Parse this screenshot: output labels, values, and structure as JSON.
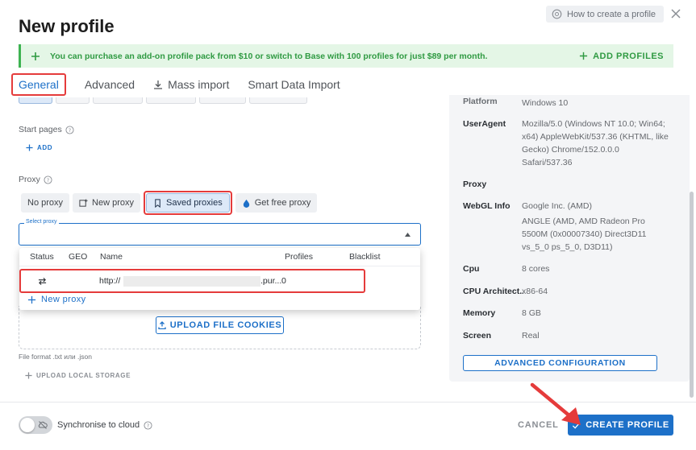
{
  "header": {
    "title": "New profile",
    "howto_label": "How to create a profile"
  },
  "banner": {
    "message": "You can purchase an add-on profile pack from $10 or switch to Base with 100 profiles for just $89 per month.",
    "action_label": "ADD PROFILES"
  },
  "tabs": [
    {
      "label": "General",
      "active": true
    },
    {
      "label": "Advanced",
      "active": false
    },
    {
      "label": "Mass import",
      "active": false
    },
    {
      "label": "Smart Data Import",
      "active": false
    }
  ],
  "start_pages": {
    "label": "Start pages",
    "add_label": "ADD"
  },
  "proxy": {
    "label": "Proxy",
    "buttons": [
      "No proxy",
      "New proxy",
      "Saved proxies",
      "Get free proxy"
    ],
    "select_label": "Select proxy"
  },
  "proxy_dropdown": {
    "columns": [
      "Status",
      "GEO",
      "Name",
      "Profiles",
      "Blacklist"
    ],
    "rows": [
      {
        "status_icon": "swap-arrows-icon",
        "geo": "",
        "name_prefix": "http://",
        "name_suffix": ".pur...",
        "profiles": "0",
        "blacklist": ""
      }
    ],
    "new_proxy_label": "New proxy"
  },
  "cookies": {
    "upload_label": "UPLOAD FILE COOKIES",
    "file_format": "File format .txt или .json",
    "upload_storage_label": "UPLOAD LOCAL STORAGE"
  },
  "summary": {
    "platform_key": "Platform",
    "platform_value": "Windows 10",
    "items": [
      {
        "key": "UserAgent",
        "value": "Mozilla/5.0 (Windows NT 10.0; Win64; x64) AppleWebKit/537.36 (KHTML, like Gecko) Chrome/152.0.0.0 Safari/537.36"
      },
      {
        "key": "Proxy",
        "value": ""
      },
      {
        "key": "WebGL Info",
        "value": "Google Inc. (AMD)"
      },
      {
        "key": "",
        "value": "ANGLE (AMD, AMD Radeon Pro 5500M (0x00007340) Direct3D11 vs_5_0 ps_5_0, D3D11)"
      },
      {
        "key": "Cpu",
        "value": "8 cores"
      },
      {
        "key": "CPU Architect...",
        "value": "x86-64"
      },
      {
        "key": "Memory",
        "value": "8 GB"
      },
      {
        "key": "Screen",
        "value": "Real"
      }
    ],
    "advanced_label": "ADVANCED CONFIGURATION"
  },
  "footer": {
    "sync_label": "Synchronise to cloud",
    "cancel_label": "CANCEL",
    "create_label": "CREATE PROFILE"
  },
  "colors": {
    "accent": "#1d70c8",
    "banner_bg": "#e4f6e6",
    "banner_text": "#2f9a42",
    "highlight": "#e53b3b"
  }
}
